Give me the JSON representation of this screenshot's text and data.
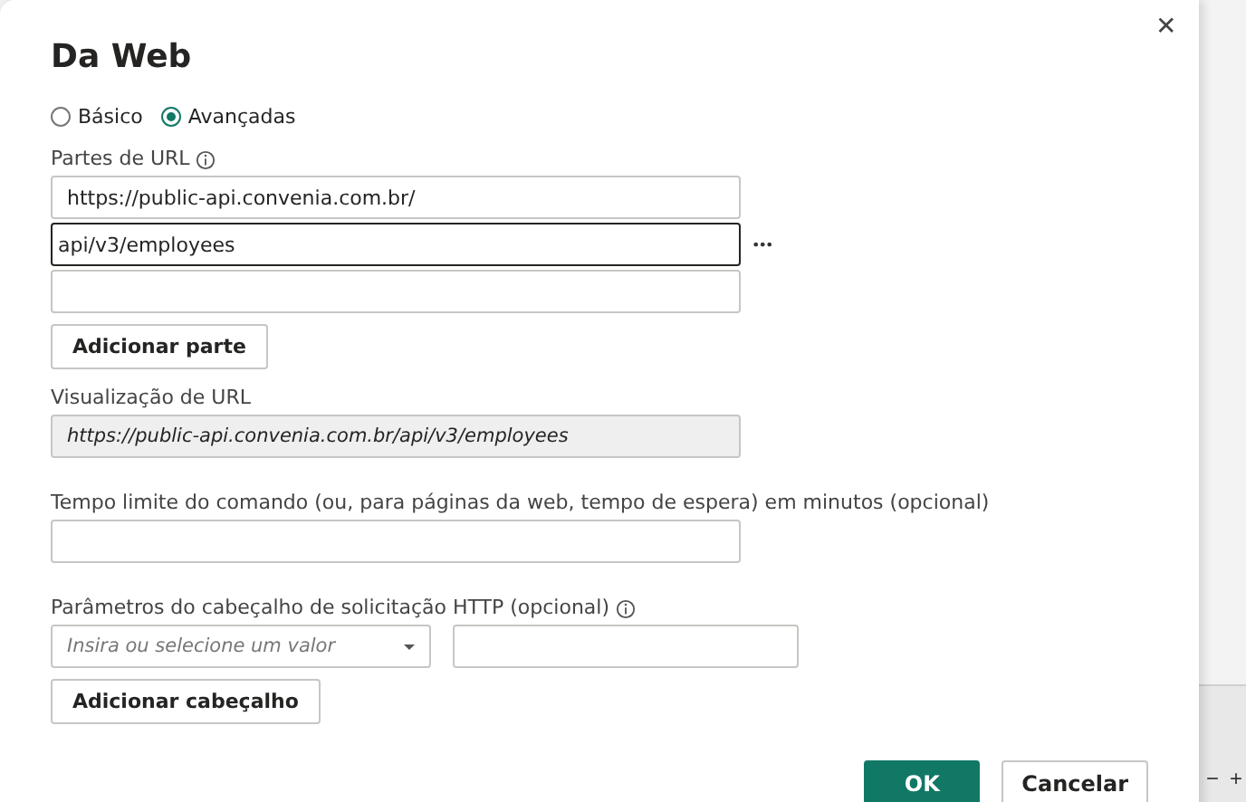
{
  "dialog": {
    "title": "Da Web",
    "close": "✕",
    "modes": [
      {
        "label": "Básico",
        "selected": false
      },
      {
        "label": "Avançadas",
        "selected": true
      }
    ],
    "url_parts": {
      "label": "Partes de URL",
      "parts": [
        {
          "value": "https://public-api.convenia.com.br/",
          "focused": false
        },
        {
          "value": "api/v3/employees",
          "focused": true
        },
        {
          "focused": false
        }
      ],
      "more": "•••",
      "add_button": "Adicionar parte"
    },
    "url_preview": {
      "label": "Visualização de URL",
      "value": "https://public-api.convenia.com.br/api/v3/employees"
    },
    "timeout": {
      "label": "Tempo limite do comando (ou, para páginas da web, tempo de espera) em minutos (opcional)"
    },
    "headers": {
      "label": "Parâmetros do cabeçalho de solicitação HTTP (opcional)",
      "key_placeholder": "Insira ou selecione um valor",
      "add_button": "Adicionar cabeçalho"
    },
    "buttons": [
      {
        "label": "OK",
        "kind": "primary"
      },
      {
        "label": "Cancelar",
        "kind": "secondary"
      }
    ]
  },
  "zoom_controls": [
    "−",
    "+"
  ]
}
